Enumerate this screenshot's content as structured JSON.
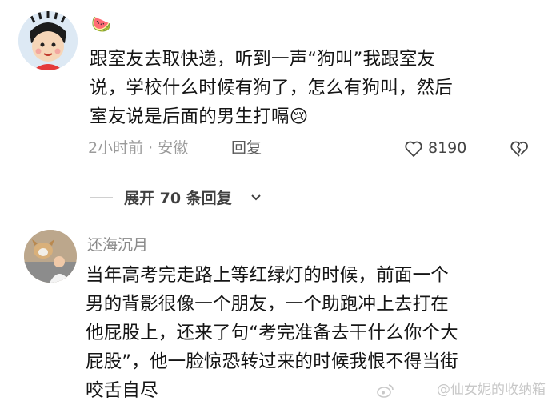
{
  "comment1": {
    "username_emoji": "🍉",
    "text_lines": [
      "跟室友去取快递，听到一声“狗叫”我跟室友",
      "说，学校什么时候有狗了，怎么有狗叫，然后",
      "室友说是后面的男生打嗝"
    ],
    "trailing_emoji": "😢",
    "meta": "2小时前 · 安徽",
    "reply_label": "回复",
    "like_count": "8190"
  },
  "expand": {
    "label": "展开 70 条回复"
  },
  "comment2": {
    "username": "还海沉月",
    "text_lines": [
      "当年高考完走路上等红绿灯的时候，前面一个",
      "男的背影很像一个朋友，一个助跑冲上去打在",
      "他屁股上，还来了句“考完准备去干什么你个大",
      "屁股”，他一脸惊恐转过来的时候我恨不得当街",
      "咬舌自尽"
    ]
  },
  "watermark": {
    "text": "@仙女妮的收纳箱"
  },
  "icons": {
    "like": "heart-outline-icon",
    "dislike": "broken-heart-icon",
    "expand": "chevron-down-icon",
    "watermark": "weibo-icon"
  }
}
